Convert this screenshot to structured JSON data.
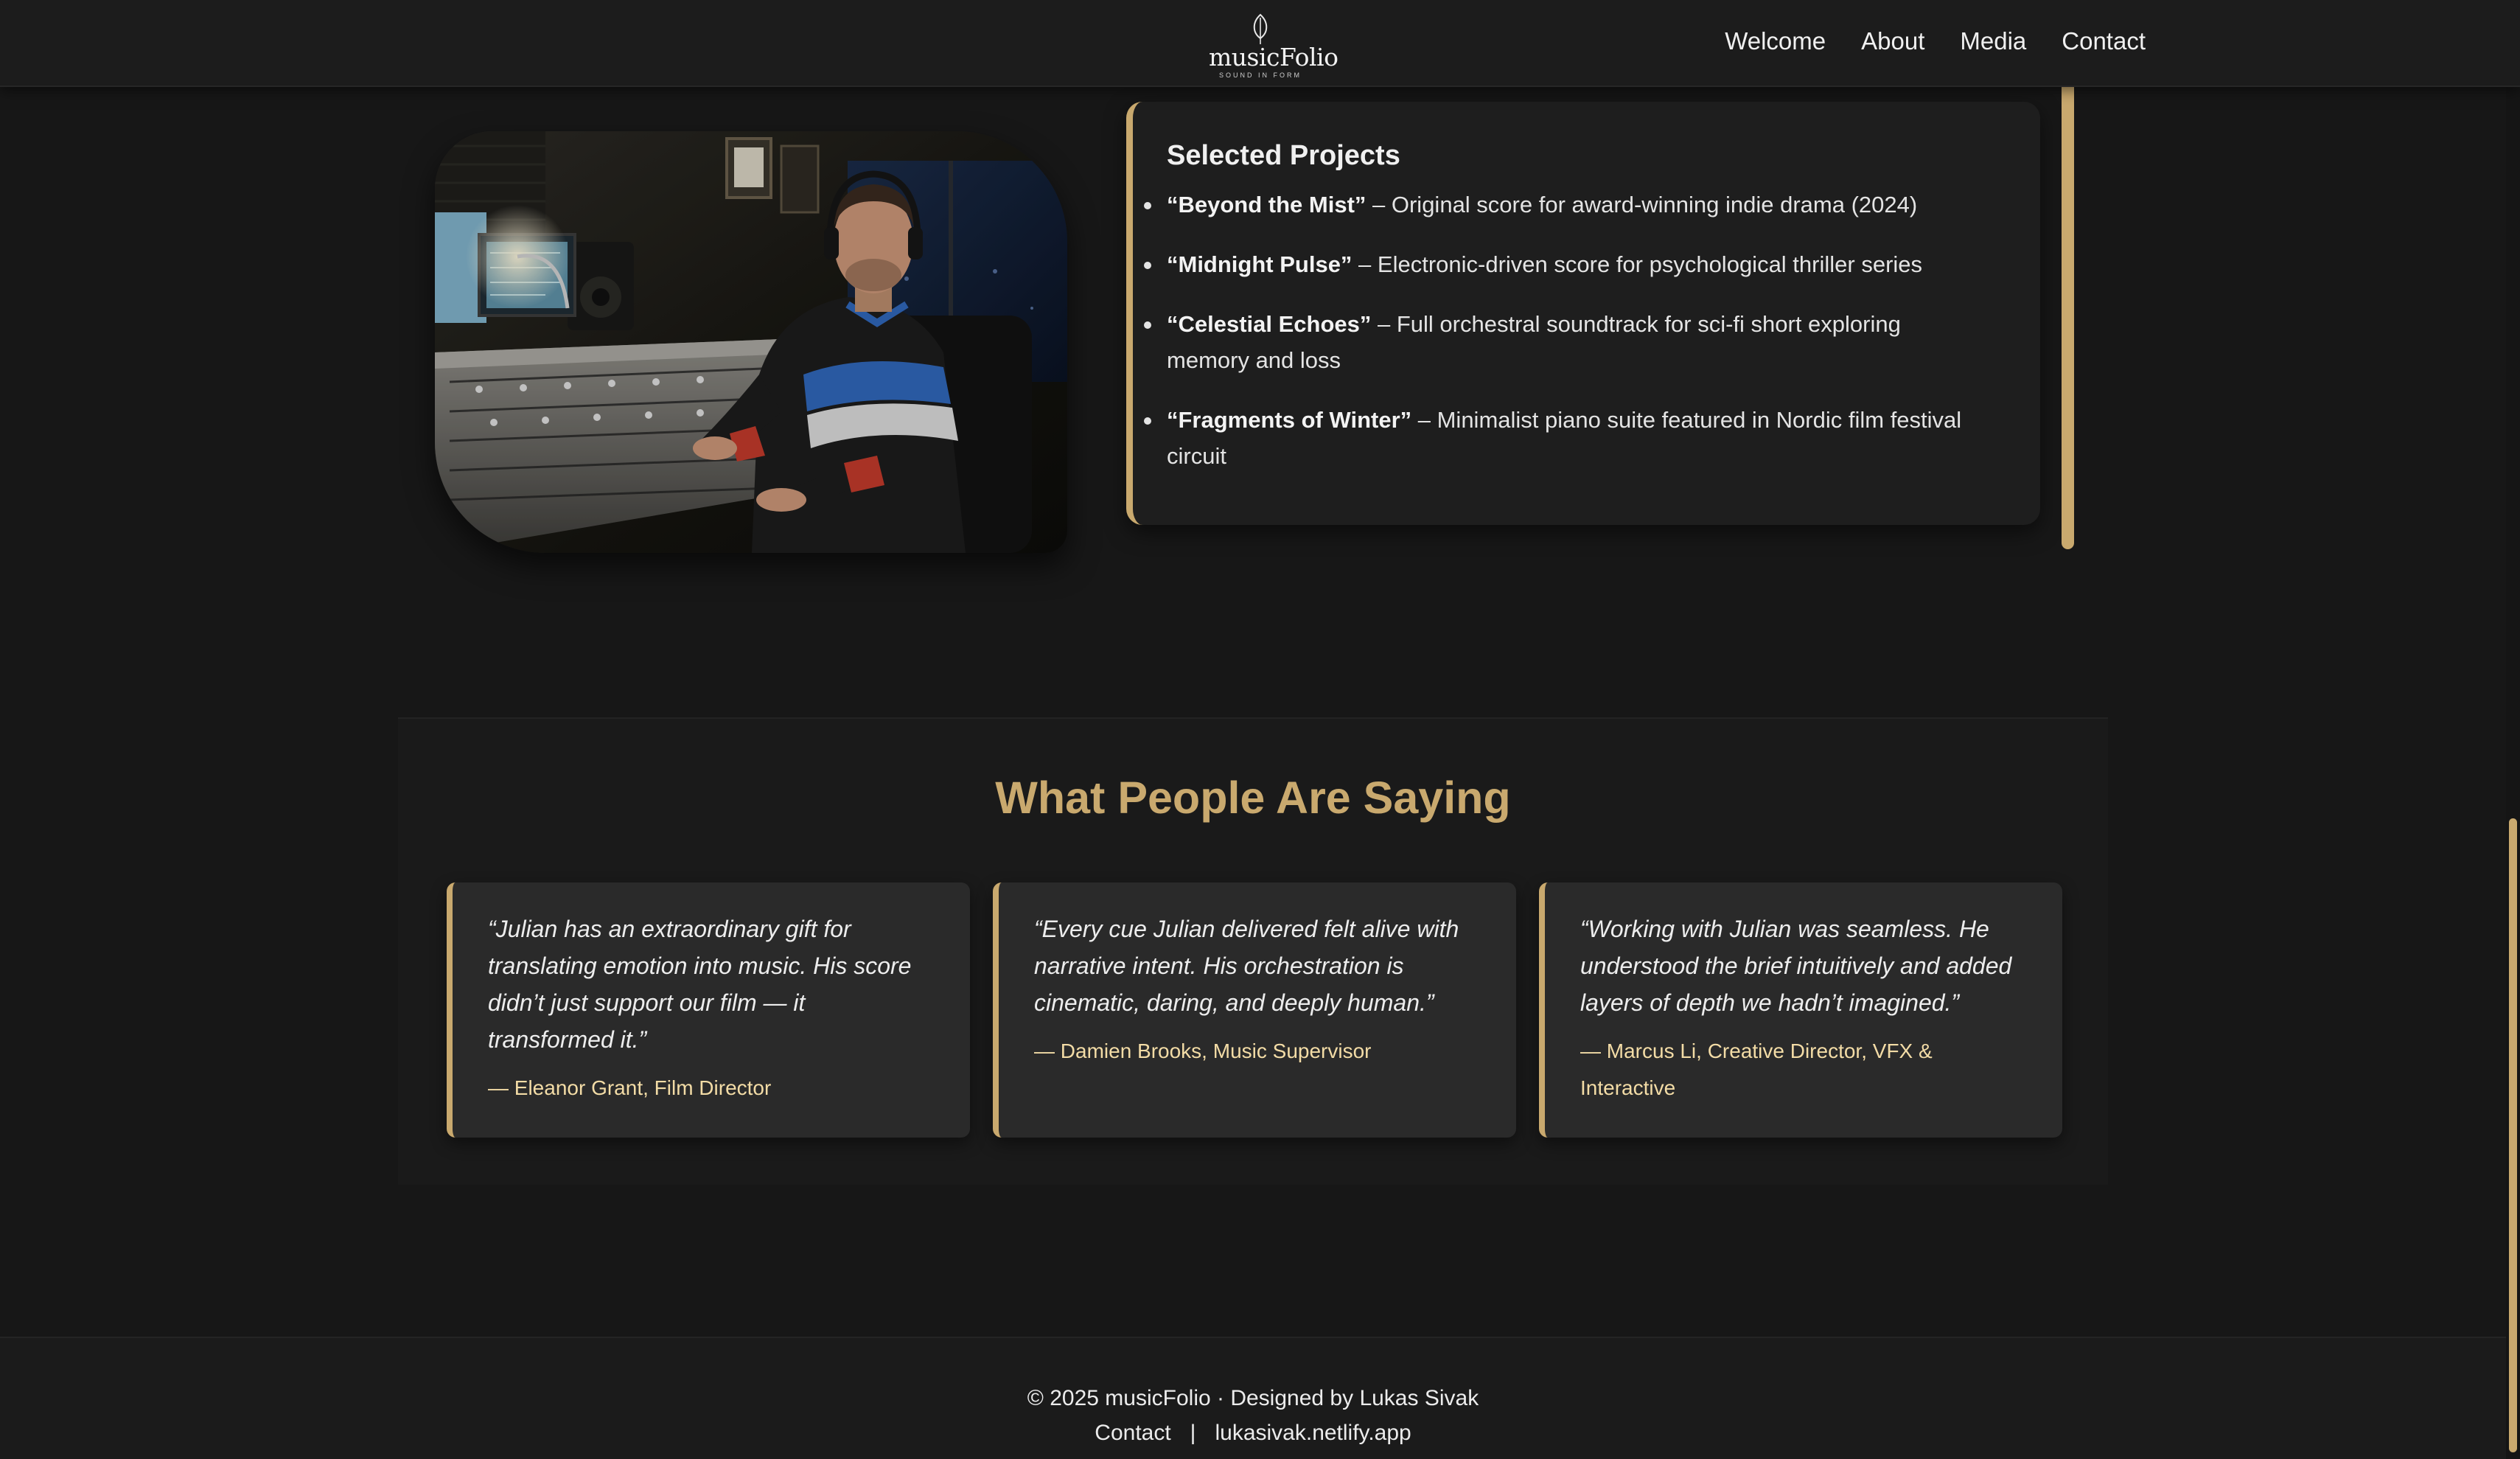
{
  "colors": {
    "background": "#171717",
    "accent_gold": "#c9a96e",
    "card": "#2a2a2a",
    "author_text": "#f3dca6"
  },
  "header": {
    "logo_name": "musicFolio",
    "logo_tagline": "SOUND IN FORM",
    "logo_icon": "leaf-icon",
    "nav": [
      {
        "label": "Welcome"
      },
      {
        "label": "About"
      },
      {
        "label": "Media"
      },
      {
        "label": "Contact"
      }
    ]
  },
  "hero_photo": {
    "icon": "composer-studio-photo"
  },
  "projects": {
    "title": "Selected Projects",
    "items": [
      {
        "name": "“Beyond the Mist”",
        "desc": " – Original score for award-winning indie drama (2024)"
      },
      {
        "name": "“Midnight Pulse”",
        "desc": " – Electronic-driven score for psychological thriller series"
      },
      {
        "name": "“Celestial Echoes”",
        "desc": " – Full orchestral soundtrack for sci-fi short exploring memory and loss"
      },
      {
        "name": "“Fragments of Winter”",
        "desc": " – Minimalist piano suite featured in Nordic film festival circuit"
      }
    ]
  },
  "testimonials": {
    "heading": "What People Are Saying",
    "items": [
      {
        "quote": "“Julian has an extraordinary gift for translating emotion into music. His score didn’t just support our film — it transformed it.”",
        "author": "— Eleanor Grant, Film Director"
      },
      {
        "quote": "“Every cue Julian delivered felt alive with narrative intent. His orchestration is cinematic, daring, and deeply human.”",
        "author": "— Damien Brooks, Music Supervisor"
      },
      {
        "quote": "“Working with Julian was seamless. He understood the brief intuitively and added layers of depth we hadn’t imagined.”",
        "author": "— Marcus Li, Creative Director, VFX & Interactive"
      }
    ]
  },
  "footer": {
    "copyright": "© 2025 musicFolio · Designed by Lukas Sivak",
    "contact_label": "Contact",
    "separator": "|",
    "site_link": "lukasivak.netlify.app"
  }
}
